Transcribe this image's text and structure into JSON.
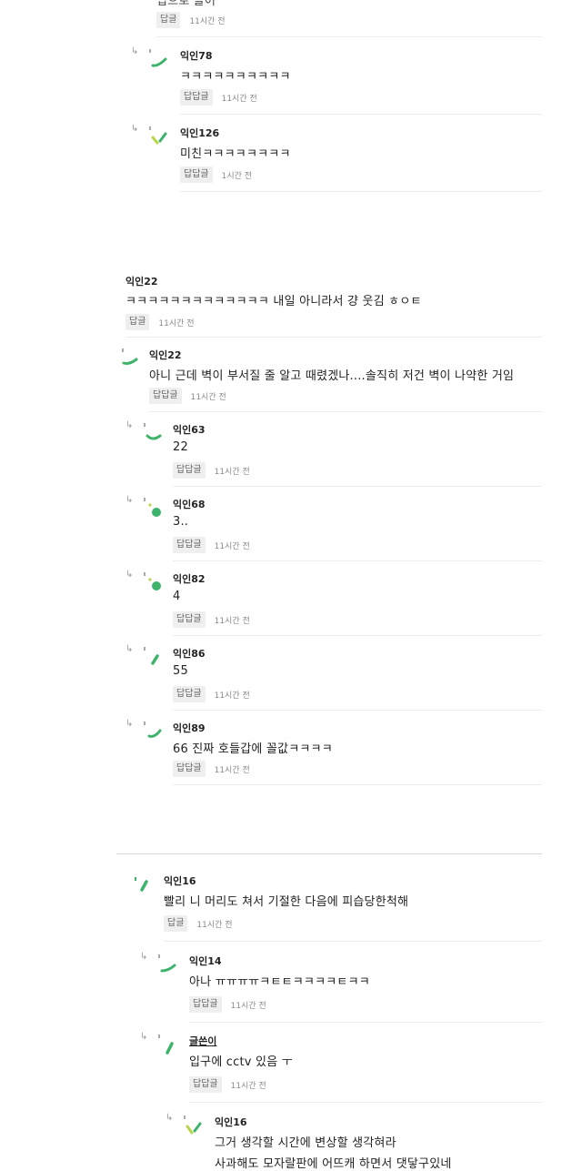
{
  "comments": [
    {
      "author": "",
      "text": "",
      "reply_label": "답글",
      "time": "11시간 전"
    },
    {
      "author": "익인78",
      "text": "ㅋㅋㅋㅋㅋㅋㅋㅋㅋㅋ",
      "reply_label": "답답글",
      "time": "11시간 전"
    },
    {
      "author": "익인126",
      "text": "미친ㅋㅋㅋㅋㅋㅋㅋㅋ",
      "reply_label": "답답글",
      "time": "1시간 전"
    },
    {
      "author": "익인22",
      "text": "ㅋㅋㅋㅋㅋㅋㅋㅋㅋㅋㅋㅋㅋ 내일 아니라서 걍 웃김 ㅎㅇㅌ",
      "reply_label": "답글",
      "time": "11시간 전"
    },
    {
      "author": "익인22",
      "text": "아니 근데 벽이 부서질 줄 알고 때렸겠나....솔직히 저건 벽이 나약한 거임",
      "reply_label": "답답글",
      "time": "11시간 전"
    },
    {
      "author": "익인63",
      "text": "22",
      "reply_label": "답답글",
      "time": "11시간 전"
    },
    {
      "author": "익인68",
      "text": "3..",
      "reply_label": "답답글",
      "time": "11시간 전"
    },
    {
      "author": "익인82",
      "text": "4",
      "reply_label": "답답글",
      "time": "11시간 전"
    },
    {
      "author": "익인86",
      "text": "55",
      "reply_label": "답답글",
      "time": "11시간 전"
    },
    {
      "author": "익인89",
      "text": "66 진짜 호들갑에 꼴값ㅋㅋㅋㅋ",
      "reply_label": "답답글",
      "time": "11시간 전"
    },
    {
      "author": "익인16",
      "text": "빨리 니 머리도 쳐서 기절한 다음에 피습당한척해",
      "reply_label": "답글",
      "time": "11시간 전"
    },
    {
      "author": "익인14",
      "text": "아나 ㅠㅠㅠㅠㅋㅌㅌㅋㅋㅋㅋㅌㅋㅋ",
      "reply_label": "답답글",
      "time": "11시간 전"
    },
    {
      "author": "글쓴이",
      "text": "입구에 cctv 있음 ㅜ",
      "reply_label": "답답글",
      "time": "11시간 전"
    },
    {
      "author": "익인16",
      "text": "그거 생각할 시간에 변상할 생각혀라",
      "text2": "사과해도 모자랄판에 어뜨캐 하면서 댓닿구있네",
      "reply_label": "",
      "time": ""
    }
  ],
  "colors": {
    "accent_green": "#3db36b",
    "lime": "#b7d64a"
  },
  "icons": {
    "reply_arrow": "reply-arrow-icon"
  }
}
